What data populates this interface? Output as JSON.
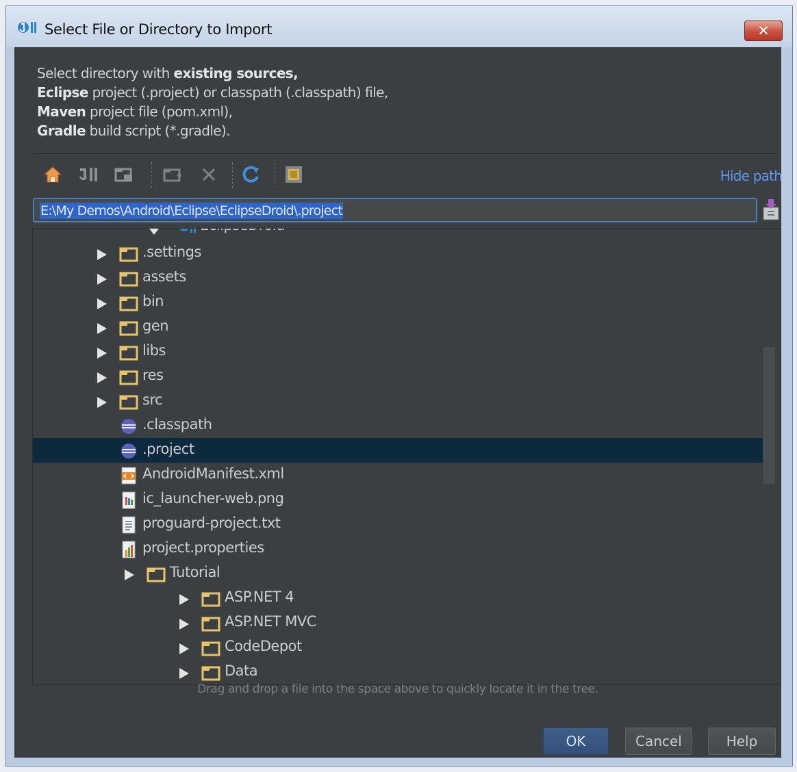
{
  "window": {
    "title": "Select File or Directory to Import",
    "close_glyph": "✕"
  },
  "description": {
    "line1_normal": "Select directory with ",
    "line1_bold": "existing sources",
    "line1_tail": ",",
    "line2_bold": "Eclipse",
    "line2_normal": " project (.project) or classpath (.classpath) file,",
    "line3_bold": "Maven",
    "line3_normal": " project file (pom.xml),",
    "line4_bold": "Gradle",
    "line4_normal": " build script (*.gradle)."
  },
  "toolbar": {
    "icons": [
      "home-icon",
      "project-icon",
      "desktop-icon",
      "new-folder-icon",
      "delete-icon",
      "refresh-icon",
      "show-hidden-icon"
    ],
    "hide_path_label": "Hide path"
  },
  "path_field": {
    "value": "E:\\My Demos\\Android\\Eclipse\\EclipseDroid\\.project"
  },
  "tree": {
    "partial_root": {
      "label": "EclipseDroid",
      "icon": "project-icon"
    },
    "rows": [
      {
        "label": ".settings",
        "icon": "folder-icon",
        "expandable": true
      },
      {
        "label": "assets",
        "icon": "folder-icon",
        "expandable": true
      },
      {
        "label": "bin",
        "icon": "folder-icon",
        "expandable": true
      },
      {
        "label": "gen",
        "icon": "folder-icon",
        "expandable": true
      },
      {
        "label": "libs",
        "icon": "folder-icon",
        "expandable": true
      },
      {
        "label": "res",
        "icon": "folder-icon",
        "expandable": true
      },
      {
        "label": "src",
        "icon": "folder-icon",
        "expandable": true
      },
      {
        "label": ".classpath",
        "icon": "eclipse-icon",
        "expandable": false
      },
      {
        "label": ".project",
        "icon": "eclipse-icon",
        "expandable": false,
        "selected": true
      },
      {
        "label": "AndroidManifest.xml",
        "icon": "xml-file-icon",
        "expandable": false
      },
      {
        "label": "ic_launcher-web.png",
        "icon": "image-file-icon",
        "expandable": false
      },
      {
        "label": "proguard-project.txt",
        "icon": "text-file-icon",
        "expandable": false
      },
      {
        "label": "project.properties",
        "icon": "properties-file-icon",
        "expandable": false
      },
      {
        "label": "Tutorial",
        "icon": "folder-icon",
        "expandable": true
      },
      {
        "label": "ASP.NET 4",
        "icon": "folder-icon",
        "expandable": true
      },
      {
        "label": "ASP.NET MVC",
        "icon": "folder-icon",
        "expandable": true
      },
      {
        "label": "CodeDepot",
        "icon": "folder-icon",
        "expandable": true
      },
      {
        "label": "Data",
        "icon": "folder-icon",
        "expandable": true
      }
    ]
  },
  "hint": "Drag and drop a file into the space above to quickly locate it in the tree.",
  "buttons": {
    "ok": "OK",
    "cancel": "Cancel",
    "help": "Help"
  },
  "colors": {
    "background": "#3c3f41",
    "selection": "#0d293e",
    "link": "#5f97ef",
    "path_selection": "#2f65ca",
    "folder": "#e8c46a"
  }
}
